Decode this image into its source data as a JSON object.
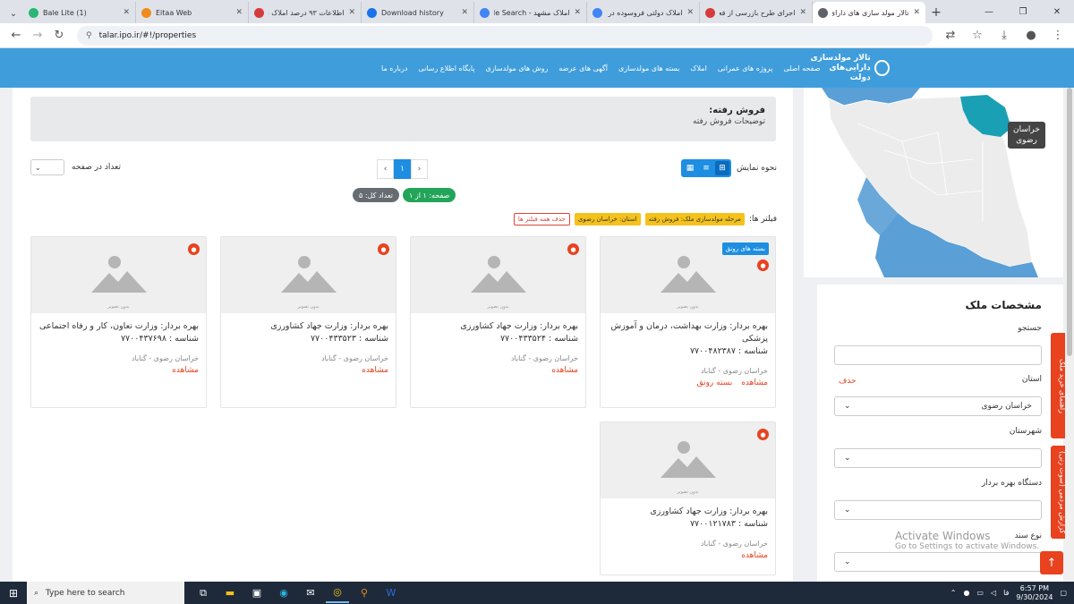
{
  "browser": {
    "tabs": [
      {
        "title": "Bale Lite (1)",
        "favicon_color": "#2ab673",
        "ltr": true,
        "active": false
      },
      {
        "title": "Eitaa Web",
        "favicon_color": "#f08a1c",
        "ltr": true,
        "active": false
      },
      {
        "title": "اطلاعات ۹۳ درصد املاک د",
        "favicon_color": "#d63b3b",
        "ltr": false,
        "active": false
      },
      {
        "title": "Download history",
        "favicon_color": "#1a73e8",
        "ltr": true,
        "active": false
      },
      {
        "title": "املاک مشهد - Google Search",
        "favicon_color": "#4285f4",
        "ltr": false,
        "active": false
      },
      {
        "title": "املاک دولتی فروسوده در ط",
        "favicon_color": "#4285f4",
        "ltr": false,
        "active": false
      },
      {
        "title": "اجرای طرح بازرسی از فعال",
        "favicon_color": "#d63b3b",
        "ltr": false,
        "active": false
      },
      {
        "title": "تالار مولد سازی های دارای",
        "favicon_color": "#5f6368",
        "ltr": false,
        "active": true
      }
    ],
    "url": "talar.ipo.ir/#!/properties"
  },
  "site": {
    "logo_line1": "تالار مولدسازی",
    "logo_line2": "دارایی‌های دولت",
    "nav": [
      "صفحه اصلی",
      "پروژه های عمرانی",
      "املاک",
      "بسته های مولدسازی",
      "آگهی های عرضه",
      "روش های مولدسازی",
      "پایگاه اطلاع رسانی",
      "درباره ما"
    ]
  },
  "content": {
    "sold_title": "فروش رفته:",
    "sold_desc": "توضیحات فروش رفته",
    "per_page_label": "تعداد در صفحه",
    "view_mode_label": "نحوه نمایش",
    "pager": {
      "prev": "‹",
      "current": "۱",
      "next": "›"
    },
    "page_badge": "صفحه: ۱ از ۱",
    "total_badge": "تعداد کل: ۵",
    "filters_label": "فیلتر ها:",
    "filter_tags": [
      "مرحله مولدسازی ملک: فروش رفته",
      "استان: خراسان رضوی"
    ],
    "clear_filters": "حذف همه فیلتر ها",
    "no_image": "بدون تصویر",
    "rownagh_badge": "بسته های رونق",
    "view_link": "مشاهده",
    "rownagh_link": "بسته رونق"
  },
  "properties": [
    {
      "owner": "بهره بردار: وزارت بهداشت، درمان و آموزش پزشکی",
      "serial": "شناسه : ۷۷۰۰۴۸۲۳۸۷",
      "location": "خراسان رضوی - گناباد",
      "featured": true
    },
    {
      "owner": "بهره بردار: وزارت جهاد کشاورزی",
      "serial": "شناسه : ۷۷۰۰۴۳۳۵۲۴",
      "location": "خراسان رضوی - گناباد",
      "featured": false
    },
    {
      "owner": "بهره بردار: وزارت جهاد کشاورزی",
      "serial": "شناسه : ۷۷۰۰۴۳۳۵۲۳",
      "location": "خراسان رضوی - گناباد",
      "featured": false
    },
    {
      "owner": "بهره بردار: وزارت تعاون، کار و رفاه اجتماعی",
      "serial": "شناسه : ۷۷۰۰۴۳۷۶۹۸",
      "location": "خراسان رضوی - گناباد",
      "featured": false
    },
    {
      "owner": "بهره بردار: وزارت جهاد کشاورزی",
      "serial": "شناسه : ۷۷۰۰۱۲۱۷۸۳",
      "location": "خراسان رضوی - گناباد",
      "featured": false
    }
  ],
  "sidebar": {
    "map_label": "خراسان\nرضوی",
    "panel_title": "مشخصات ملک",
    "search_label": "جستجو",
    "province_label": "استان",
    "province_delete": "حذف",
    "province_value": "خراسان رضوی",
    "city_label": "شهرستان",
    "operator_label": "دستگاه بهره بردار",
    "doc_type_label": "نوع سند",
    "side_btn_1": "راهنمای خرید ملک",
    "side_btn_2": "گزارش مردمی (سوت زنی)"
  },
  "windows": {
    "activate_1": "Activate Windows",
    "activate_2": "Go to Settings to activate Windows."
  },
  "taskbar": {
    "search_placeholder": "Type here to search",
    "time": "6:57 PM",
    "date": "9/30/2024",
    "lang": "فا"
  }
}
